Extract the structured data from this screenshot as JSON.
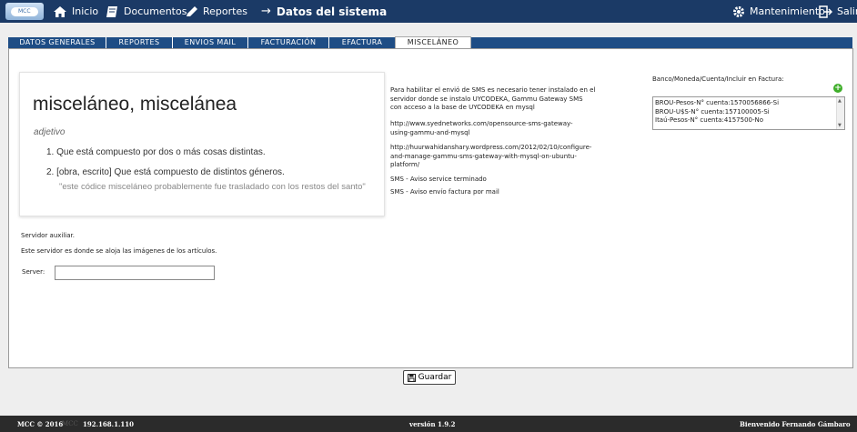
{
  "nav": {
    "logo_text": "MCC",
    "inicio": "Inicio",
    "documentos": "Documentos",
    "reportes": "Reportes",
    "title": "Datos del sistema",
    "mantenimiento": "Mantenimiento",
    "salir": "Salir"
  },
  "tabs": [
    {
      "label": "DATOS GENERALES"
    },
    {
      "label": "REPORTES"
    },
    {
      "label": "ENVIOS MAIL"
    },
    {
      "label": "FACTURACIÓN"
    },
    {
      "label": "EFACTURA"
    },
    {
      "label": "MISCELÁNEO"
    }
  ],
  "dictionary": {
    "word": "misceláneo, miscelánea",
    "pos": "adjetivo",
    "def1": "1.  Que está compuesto por dos o más cosas distintas.",
    "def2": "2.  [obra, escrito] Que está compuesto de distintos géneros.",
    "example": "\"este códice misceláneo probablemente fue trasladado con los restos del santo\""
  },
  "sms": {
    "intro1": "Para habilitar el envió de SMS es necesario tener instalado en el",
    "intro2": "servidor donde se instalo UYCODEKA, Gammu Gateway SMS",
    "intro3": "con acceso a la base de UYCODEKA en mysql",
    "link1a": "http://www.syednetworks.com/opensource-sms-gateway-",
    "link1b": "using-gammu-and-mysql",
    "link2a": "http://huurwahidanshary.wordpress.com/2012/02/10/configure-",
    "link2b": "and-manage-gammu-sms-gateway-with-mysql-on-ubuntu-",
    "link2c": "platform/",
    "service": "SMS - Aviso service terminado",
    "invoice": "SMS - Aviso envío factura por mail"
  },
  "bank": {
    "header": "Banco/Moneda/Cuenta/Incluir en Factura:",
    "line1": "BROU-Pesos-N° cuenta:1570056866-Si",
    "line2": "BROU-U$S-N° cuenta:157100005-Si",
    "line3": "Itaú-Pesos-N° cuenta:4157500-No"
  },
  "server": {
    "aux_label": "Servidor auxiliar.",
    "description": "Este servidor es donde se aloja las imágenes de los artículos.",
    "field_label": "Server:",
    "value": ""
  },
  "save_label": "Guardar",
  "footer": {
    "copyright": "MCC © 2016",
    "mcc_small": "MCC",
    "ip": "192.168.1.110",
    "version": "versión 1.9.2",
    "welcome": "Bienvenido Fernando Gámbaro"
  }
}
